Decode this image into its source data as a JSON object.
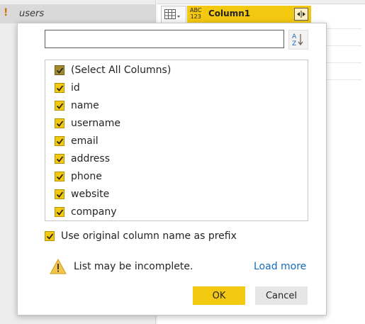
{
  "queries": {
    "items": [
      {
        "name": "users",
        "warning_glyph": "!"
      }
    ]
  },
  "grid": {
    "column_type_badge_line1": "ABC",
    "column_type_badge_line2": "123",
    "column_name": "Column1",
    "expand_icon": "expand-column-icon"
  },
  "expand_panel": {
    "search": {
      "value": "",
      "placeholder": ""
    },
    "sort_icon": "sort-ascending-icon",
    "columns": [
      {
        "label": "(Select All Columns)",
        "checked": true,
        "is_select_all": true
      },
      {
        "label": "id",
        "checked": true
      },
      {
        "label": "name",
        "checked": true
      },
      {
        "label": "username",
        "checked": true
      },
      {
        "label": "email",
        "checked": true
      },
      {
        "label": "address",
        "checked": true
      },
      {
        "label": "phone",
        "checked": true
      },
      {
        "label": "website",
        "checked": true
      },
      {
        "label": "company",
        "checked": true
      }
    ],
    "use_prefix": {
      "label": "Use original column name as prefix",
      "checked": true
    },
    "warning": {
      "text": "List may be incomplete.",
      "icon": "warning-icon"
    },
    "load_more_label": "Load more",
    "ok_label": "OK",
    "cancel_label": "Cancel"
  },
  "colors": {
    "accent": "#f2c811",
    "select_all_check": "#a38a2c",
    "link": "#0f6cbd"
  }
}
